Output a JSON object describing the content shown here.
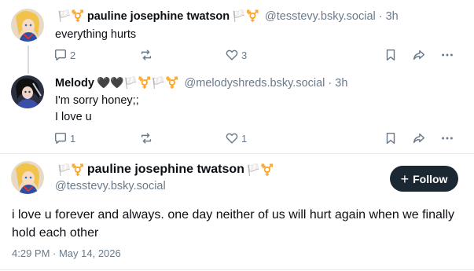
{
  "posts": [
    {
      "author_name": "pauline josephine twatson",
      "flag_left": "🏳️⚧️",
      "flag_right": "🏳️⚧️",
      "handle": "@tesstevy.bsky.social",
      "separator": "·",
      "time": "3h",
      "text_lines": [
        "everything hurts"
      ],
      "reply_count": "2",
      "repost_count": "",
      "like_count": "3"
    },
    {
      "author_name": "Melody",
      "flag_left": "🖤🖤🏳️⚧️🏳️⚧️",
      "handle": "@melodyshreds.bsky.social",
      "separator": "·",
      "time": "3h",
      "text_lines": [
        "I'm sorry honey;;",
        "I love u"
      ],
      "reply_count": "1",
      "repost_count": "",
      "like_count": "1"
    }
  ],
  "main_post": {
    "author_name": "pauline josephine twatson",
    "flag_left": "🏳️⚧️",
    "flag_right": "🏳️⚧️",
    "handle": "@tesstevy.bsky.social",
    "follow_label": "Follow",
    "text": "i love u forever and always. one day neither of us will hurt again when we finally hold each other",
    "timestamp": "4:29 PM · May 14, 2026"
  },
  "icons": {
    "reply": "reply-icon",
    "repost": "repost-icon",
    "like": "heart-icon",
    "bookmark": "bookmark-icon",
    "share": "share-icon",
    "more": "more-icon"
  },
  "colors": {
    "muted": "#6b7a89",
    "follow_bg": "#1b2733",
    "thread_line": "#d4dbe2"
  }
}
